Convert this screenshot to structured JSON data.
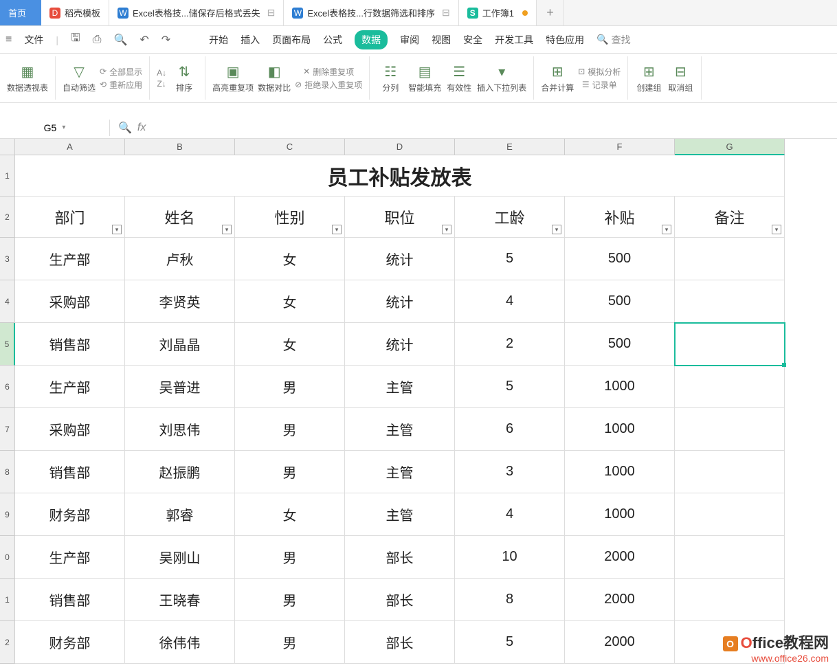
{
  "tabs": {
    "home": "首页",
    "t1": "稻壳模板",
    "t2": "Excel表格技...储保存后格式丢失",
    "t3": "Excel表格技...行数据筛选和排序",
    "t4": "工作簿1"
  },
  "menu": {
    "file": "文件",
    "start": "开始",
    "insert": "插入",
    "layout": "页面布局",
    "formula": "公式",
    "data": "数据",
    "review": "审阅",
    "view": "视图",
    "security": "安全",
    "dev": "开发工具",
    "feature": "特色应用",
    "search": "查找"
  },
  "ribbon": {
    "pivot": "数据透视表",
    "autofilter": "自动筛选",
    "showall": "全部显示",
    "reapply": "重新应用",
    "sort": "排序",
    "dedup": "高亮重复项",
    "compare": "数据对比",
    "delrep": "删除重复项",
    "reject": "拒绝录入重复项",
    "split": "分列",
    "flash": "智能填充",
    "valid": "有效性",
    "dropdown": "插入下拉列表",
    "consol": "合并计算",
    "sim": "模拟分析",
    "record": "记录单",
    "group": "创建组",
    "ungroup": "取消组"
  },
  "namebox": {
    "cell": "G5"
  },
  "cols": [
    "A",
    "B",
    "C",
    "D",
    "E",
    "F",
    "G"
  ],
  "rows": [
    "1",
    "2",
    "3",
    "4",
    "5",
    "6",
    "7",
    "8",
    "9",
    "0",
    "1",
    "2"
  ],
  "table": {
    "title": "员工补贴发放表",
    "headers": [
      "部门",
      "姓名",
      "性别",
      "职位",
      "工龄",
      "补贴",
      "备注"
    ],
    "data": [
      [
        "生产部",
        "卢秋",
        "女",
        "统计",
        "5",
        "500",
        ""
      ],
      [
        "采购部",
        "李贤英",
        "女",
        "统计",
        "4",
        "500",
        ""
      ],
      [
        "销售部",
        "刘晶晶",
        "女",
        "统计",
        "2",
        "500",
        ""
      ],
      [
        "生产部",
        "吴普进",
        "男",
        "主管",
        "5",
        "1000",
        ""
      ],
      [
        "采购部",
        "刘思伟",
        "男",
        "主管",
        "6",
        "1000",
        ""
      ],
      [
        "销售部",
        "赵振鹏",
        "男",
        "主管",
        "3",
        "1000",
        ""
      ],
      [
        "财务部",
        "郭睿",
        "女",
        "主管",
        "4",
        "1000",
        ""
      ],
      [
        "生产部",
        "吴刚山",
        "男",
        "部长",
        "10",
        "2000",
        ""
      ],
      [
        "销售部",
        "王晓春",
        "男",
        "部长",
        "8",
        "2000",
        ""
      ],
      [
        "财务部",
        "徐伟伟",
        "男",
        "部长",
        "5",
        "2000",
        ""
      ]
    ]
  },
  "watermark": {
    "brand": "Office教程网",
    "url": "www.office26.com"
  }
}
